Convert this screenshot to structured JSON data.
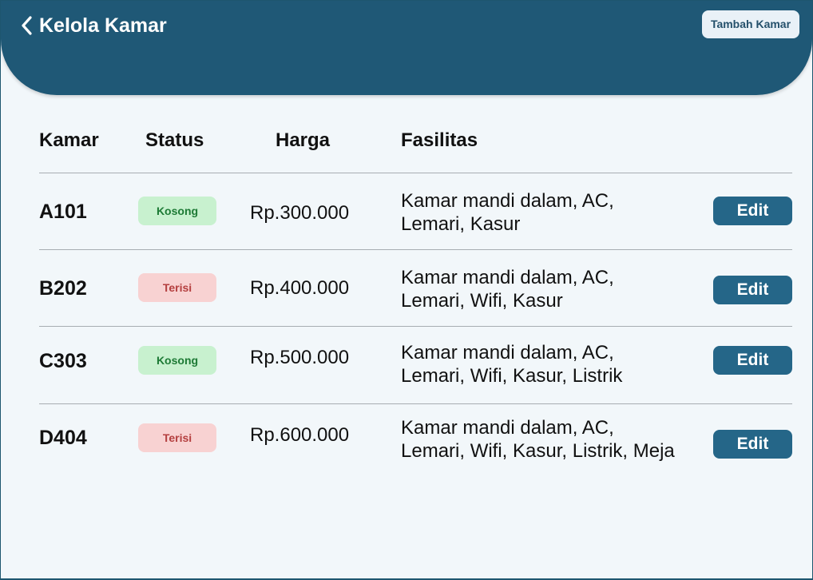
{
  "header": {
    "title": "Kelola Kamar",
    "back_icon": "chevron-left-icon",
    "add_button_label": "Tambah Kamar"
  },
  "table": {
    "columns": [
      "Kamar",
      "Status",
      "Harga",
      "Fasilitas"
    ],
    "rows": [
      {
        "kamar": "A101",
        "status": "Kosong",
        "harga": "Rp.300.000",
        "fasilitas": "Kamar mandi dalam, AC, Lemari, Kasur",
        "edit_label": "Edit"
      },
      {
        "kamar": "B202",
        "status": "Terisi",
        "harga": "Rp.400.000",
        "fasilitas": "Kamar mandi dalam, AC, Lemari, Wifi, Kasur",
        "edit_label": "Edit"
      },
      {
        "kamar": "C303",
        "status": "Kosong",
        "harga": "Rp.500.000",
        "fasilitas": "Kamar mandi dalam, AC, Lemari, Wifi, Kasur, Listrik",
        "edit_label": "Edit"
      },
      {
        "kamar": "D404",
        "status": "Terisi",
        "harga": "Rp.600.000",
        "fasilitas": "Kamar mandi dalam, AC, Lemari, Wifi, Kasur, Listrik, Meja",
        "edit_label": "Edit"
      }
    ]
  },
  "colors": {
    "header_bg": "#1f5876",
    "page_bg": "#f2f7fa",
    "edit_button": "#256688",
    "status_kosong_bg": "#c8f1cf",
    "status_kosong_text": "#1d7a35",
    "status_terisi_bg": "#f8d2d2",
    "status_terisi_text": "#b43f3f"
  }
}
